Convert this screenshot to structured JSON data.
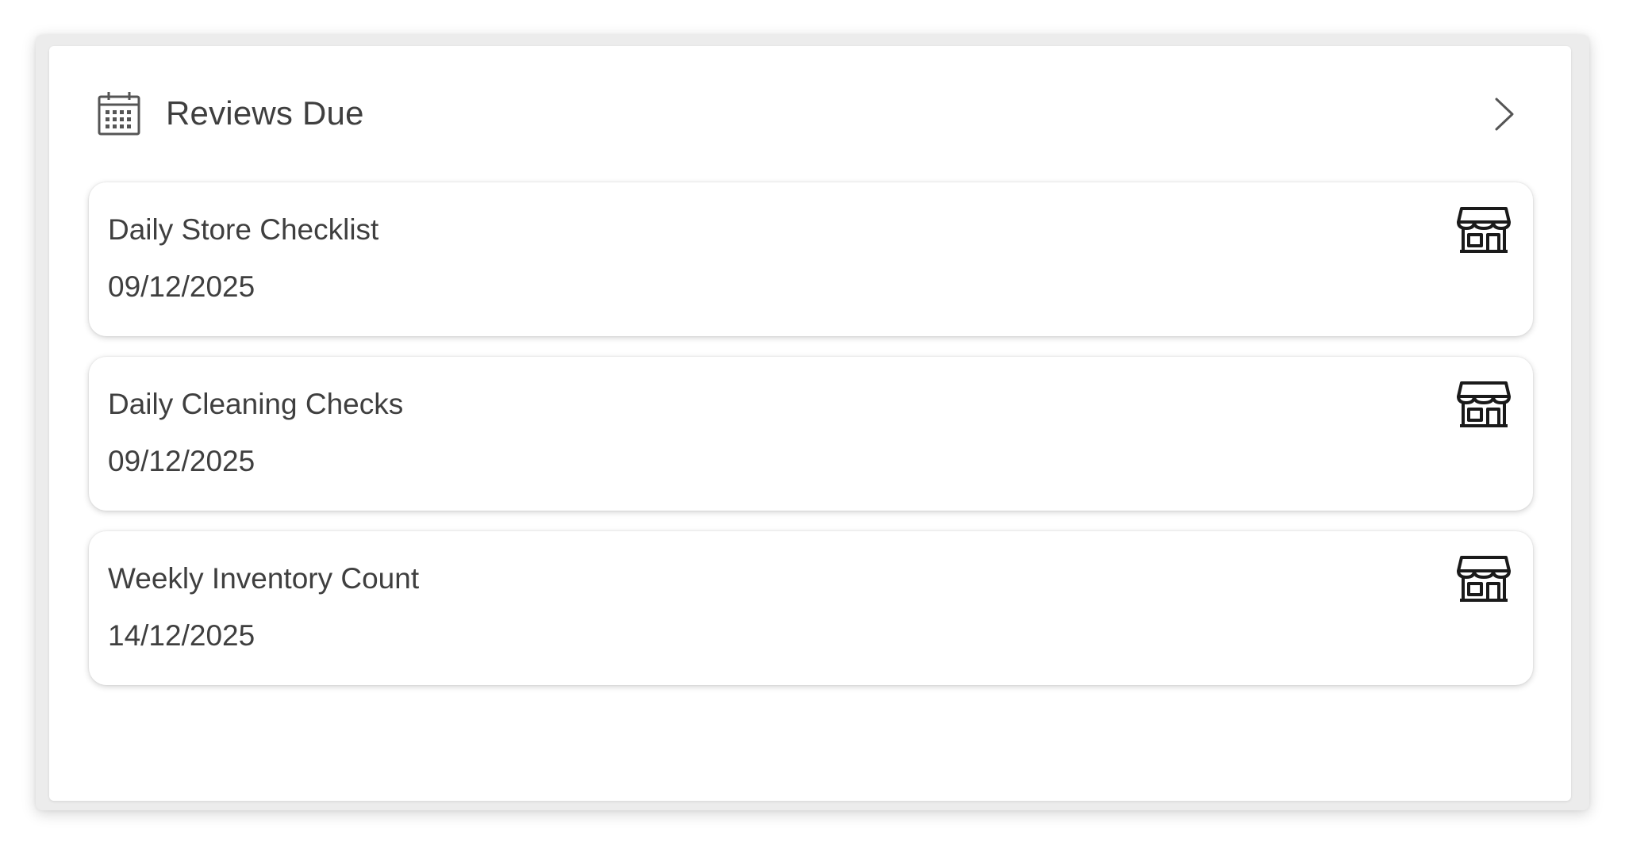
{
  "panel": {
    "title": "Reviews Due",
    "header_icon": "calendar-icon",
    "action_icon": "chevron-right-icon"
  },
  "reviews": [
    {
      "title": "Daily Store Checklist",
      "date": "09/12/2025",
      "icon": "store-icon"
    },
    {
      "title": "Daily Cleaning Checks",
      "date": "09/12/2025",
      "icon": "store-icon"
    },
    {
      "title": "Weekly Inventory Count",
      "date": "14/12/2025",
      "icon": "store-icon"
    }
  ],
  "colors": {
    "text": "#3f3f3f",
    "icon": "#1a1a1a",
    "frame": "#ececec",
    "card": "#ffffff"
  }
}
